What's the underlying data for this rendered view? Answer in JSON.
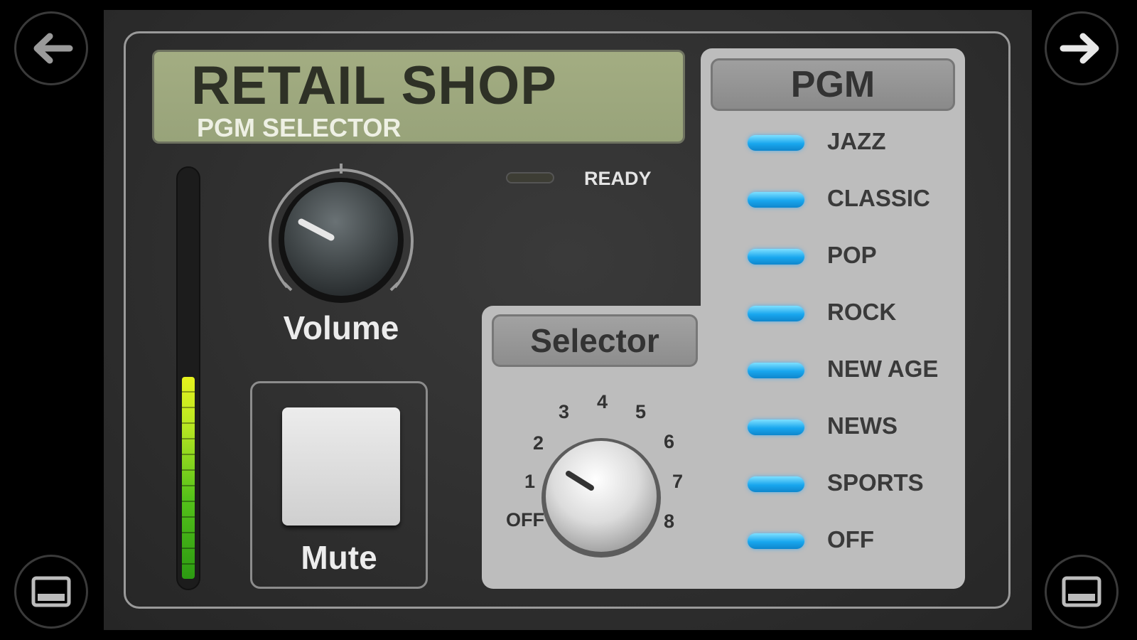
{
  "nav": {
    "back_icon": "arrow-left-icon",
    "forward_icon": "arrow-right-icon",
    "left_bottom_icon": "window-icon",
    "right_bottom_icon": "window-icon"
  },
  "display": {
    "title": "RETAIL SHOP",
    "subtitle": "PGM SELECTOR"
  },
  "status": {
    "ready_label": "READY",
    "ready_on": false
  },
  "volume": {
    "label": "Volume"
  },
  "meter": {
    "level": 0.5
  },
  "mute": {
    "label": "Mute"
  },
  "selector": {
    "label": "Selector",
    "positions": [
      "OFF",
      "1",
      "2",
      "3",
      "4",
      "5",
      "6",
      "7",
      "8"
    ]
  },
  "pgm": {
    "header": "PGM",
    "items": [
      {
        "label": "JAZZ",
        "led_color": "#18a6ee"
      },
      {
        "label": "CLASSIC",
        "led_color": "#18a6ee"
      },
      {
        "label": "POP",
        "led_color": "#18a6ee"
      },
      {
        "label": "ROCK",
        "led_color": "#18a6ee"
      },
      {
        "label": "NEW AGE",
        "led_color": "#18a6ee"
      },
      {
        "label": "NEWS",
        "led_color": "#18a6ee"
      },
      {
        "label": "SPORTS",
        "led_color": "#18a6ee"
      },
      {
        "label": "OFF",
        "led_color": "#18a6ee"
      }
    ]
  },
  "colors": {
    "lcd_background": "#9ca67d",
    "panel_background": "#2f2f2f",
    "light_panel": "#bdbdbd"
  }
}
